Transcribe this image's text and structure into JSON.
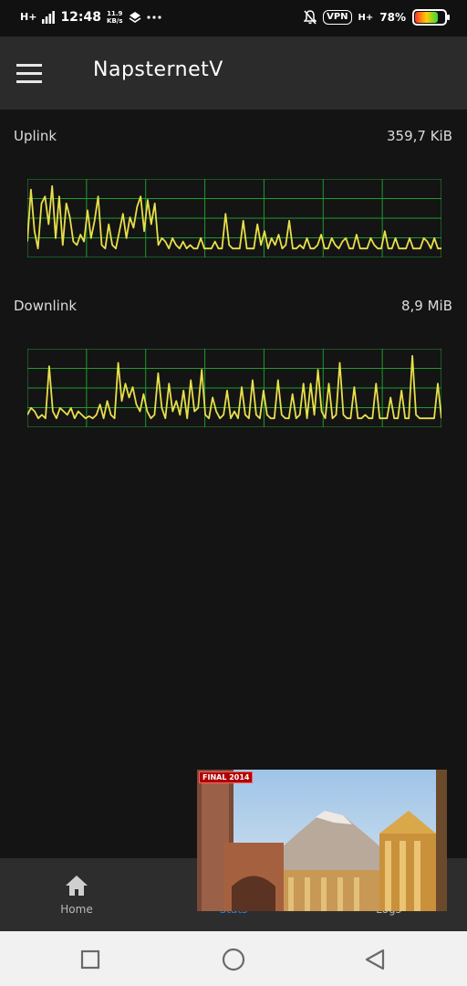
{
  "status_bar": {
    "network_type": "H+",
    "time": "12:48",
    "speed_value": "11.9",
    "speed_unit": "KB/s",
    "vpn_label": "VPN",
    "network_type_2": "H+",
    "battery_percent": "78%",
    "battery_level": 0.78,
    "icons": [
      "signal-icon",
      "layers-icon",
      "more-dots-icon",
      "mute-bell-icon",
      "vpn-icon",
      "data-arrows-icon",
      "battery-icon"
    ]
  },
  "app_bar": {
    "title": "NapsternetV",
    "menu_icon": "hamburger-menu-icon"
  },
  "uplink": {
    "label": "Uplink",
    "value": "359,7 KiB",
    "line_color": "#e8df4a",
    "grid_color": "#1f9a2f",
    "samples": [
      0.15,
      0.9,
      0.3,
      0.05,
      0.7,
      0.8,
      0.4,
      0.95,
      0.2,
      0.8,
      0.1,
      0.7,
      0.5,
      0.15,
      0.1,
      0.25,
      0.15,
      0.6,
      0.2,
      0.45,
      0.8,
      0.1,
      0.05,
      0.4,
      0.1,
      0.05,
      0.3,
      0.55,
      0.2,
      0.5,
      0.35,
      0.65,
      0.8,
      0.3,
      0.75,
      0.4,
      0.7,
      0.1,
      0.2,
      0.15,
      0.05,
      0.2,
      0.1,
      0.05,
      0.15,
      0.05,
      0.1,
      0.05,
      0.05,
      0.2,
      0.05,
      0.05,
      0.05,
      0.15,
      0.05,
      0.05,
      0.55,
      0.1,
      0.05,
      0.05,
      0.05,
      0.45,
      0.05,
      0.05,
      0.05,
      0.4,
      0.1,
      0.3,
      0.05,
      0.2,
      0.1,
      0.25,
      0.05,
      0.1,
      0.45,
      0.05,
      0.05,
      0.1,
      0.05,
      0.2,
      0.05,
      0.05,
      0.1,
      0.25,
      0.05,
      0.05,
      0.2,
      0.1,
      0.05,
      0.15,
      0.2,
      0.05,
      0.05,
      0.25,
      0.05,
      0.05,
      0.05,
      0.2,
      0.1,
      0.05,
      0.05,
      0.3,
      0.05,
      0.05,
      0.2,
      0.05,
      0.05,
      0.05,
      0.2,
      0.05,
      0.05,
      0.05,
      0.2,
      0.15,
      0.05,
      0.2,
      0.05,
      0.05
    ]
  },
  "downlink": {
    "label": "Downlink",
    "value": "8,9 MiB",
    "line_color": "#e8df4a",
    "grid_color": "#1f9a2f",
    "samples": [
      0.1,
      0.2,
      0.15,
      0.05,
      0.1,
      0.05,
      0.8,
      0.15,
      0.05,
      0.2,
      0.15,
      0.1,
      0.2,
      0.05,
      0.15,
      0.1,
      0.05,
      0.08,
      0.05,
      0.1,
      0.25,
      0.05,
      0.3,
      0.1,
      0.05,
      0.85,
      0.3,
      0.55,
      0.35,
      0.5,
      0.25,
      0.15,
      0.4,
      0.15,
      0.05,
      0.1,
      0.7,
      0.2,
      0.05,
      0.55,
      0.15,
      0.3,
      0.1,
      0.45,
      0.05,
      0.6,
      0.15,
      0.2,
      0.75,
      0.1,
      0.05,
      0.35,
      0.15,
      0.05,
      0.1,
      0.45,
      0.05,
      0.15,
      0.05,
      0.5,
      0.1,
      0.05,
      0.6,
      0.1,
      0.05,
      0.45,
      0.1,
      0.05,
      0.05,
      0.6,
      0.1,
      0.05,
      0.05,
      0.4,
      0.05,
      0.1,
      0.55,
      0.05,
      0.55,
      0.1,
      0.75,
      0.15,
      0.05,
      0.55,
      0.05,
      0.1,
      0.85,
      0.1,
      0.05,
      0.05,
      0.5,
      0.05,
      0.05,
      0.1,
      0.05,
      0.05,
      0.55,
      0.05,
      0.05,
      0.05,
      0.35,
      0.05,
      0.05,
      0.45,
      0.05,
      0.05,
      0.95,
      0.1,
      0.05,
      0.05,
      0.05,
      0.05,
      0.05,
      0.55,
      0.05
    ]
  },
  "bottom_nav": {
    "items": [
      {
        "label": "Home",
        "icon": "home-icon",
        "active": false
      },
      {
        "label": "Stats",
        "icon": "stats-icon",
        "active": true
      },
      {
        "label": "Logs",
        "icon": "logs-icon",
        "active": false
      }
    ]
  },
  "video_overlay": {
    "badge": "FINAL 2014"
  },
  "system_nav": {
    "icons": [
      "recent-apps-icon",
      "home-circle-icon",
      "back-icon"
    ]
  }
}
